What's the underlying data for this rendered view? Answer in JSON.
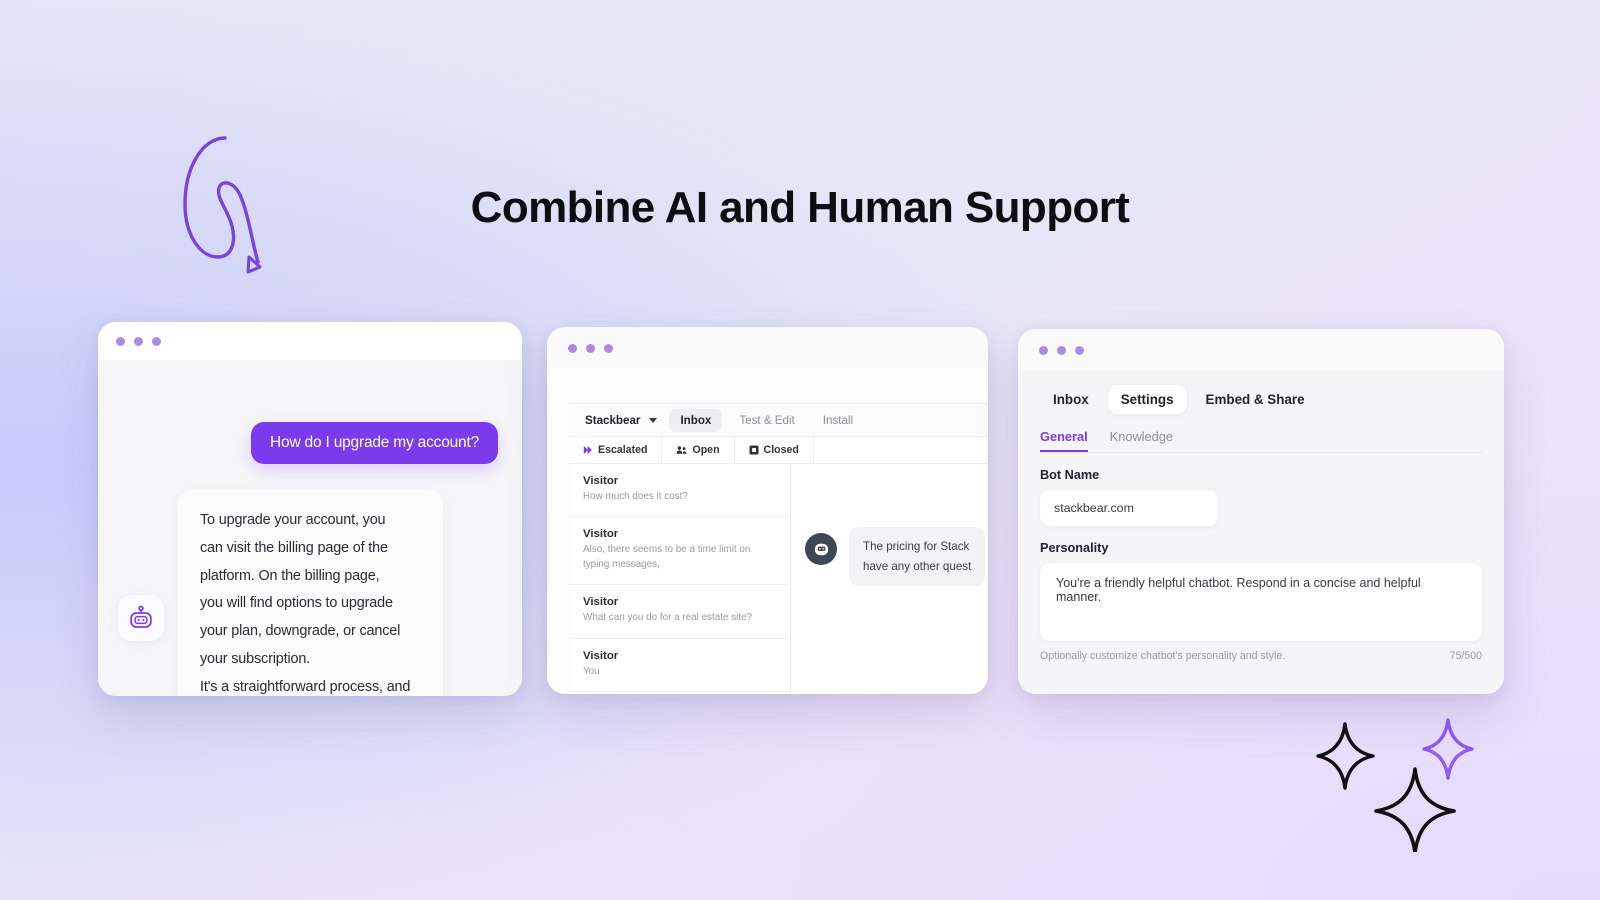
{
  "headline": "Combine AI and Human Support",
  "decorations": {
    "arrow_icon": "curly-arrow-icon",
    "sparkle_icons": [
      "sparkle-icon",
      "sparkle-icon",
      "sparkle-icon"
    ],
    "accent_purple": "#7c3aed",
    "dot_purple": "#a98ce0"
  },
  "card_chat": {
    "window_dots": 3,
    "user_message": "How do I upgrade my account?",
    "bot_avatar_icon": "robot-icon",
    "bot_message": "To upgrade your account, you\ncan visit the billing page of the\nplatform. On the billing page,\nyou will find options to upgrade\nyour plan, downgrade, or cancel\nyour subscription.\nIt's a straightforward process, and\nyou can make changes at any time."
  },
  "card_inbox": {
    "window_dots": 3,
    "brand": "Stackbear",
    "brand_caret_icon": "chevron-down-icon",
    "tabs": [
      {
        "label": "Inbox",
        "active": true
      },
      {
        "label": "Test & Edit",
        "active": false
      },
      {
        "label": "Install",
        "active": false
      }
    ],
    "filters": [
      {
        "label": "Escalated",
        "icon": "escalate-chevrons-icon"
      },
      {
        "label": "Open",
        "icon": "people-icon"
      },
      {
        "label": "Closed",
        "icon": "archive-box-icon"
      }
    ],
    "conversations": [
      {
        "name": "Visitor",
        "preview": "How much does it cost?"
      },
      {
        "name": "Visitor",
        "preview": "Also, there seems to be a time limit on typing messages,"
      },
      {
        "name": "Visitor",
        "preview": "What can you do for a real estate site?"
      },
      {
        "name": "Visitor",
        "preview": "You"
      }
    ],
    "thread": {
      "bot_avatar_icon": "robot-icon",
      "message_line1": "The pricing for Stack",
      "message_line2": "have any other quest"
    }
  },
  "card_settings": {
    "window_dots": 3,
    "tabs": [
      {
        "label": "Inbox",
        "active": false
      },
      {
        "label": "Settings",
        "active": true
      },
      {
        "label": "Embed & Share",
        "active": false
      }
    ],
    "subtabs": [
      {
        "label": "General",
        "active": true
      },
      {
        "label": "Knowledge",
        "active": false
      }
    ],
    "bot_name": {
      "label": "Bot Name",
      "value": "stackbear.com"
    },
    "personality": {
      "label": "Personality",
      "value": "You're a friendly helpful chatbot. Respond in a concise and helpful manner.",
      "helper": "Optionally customize chatbot's personality and style.",
      "counter": "75/500"
    }
  }
}
